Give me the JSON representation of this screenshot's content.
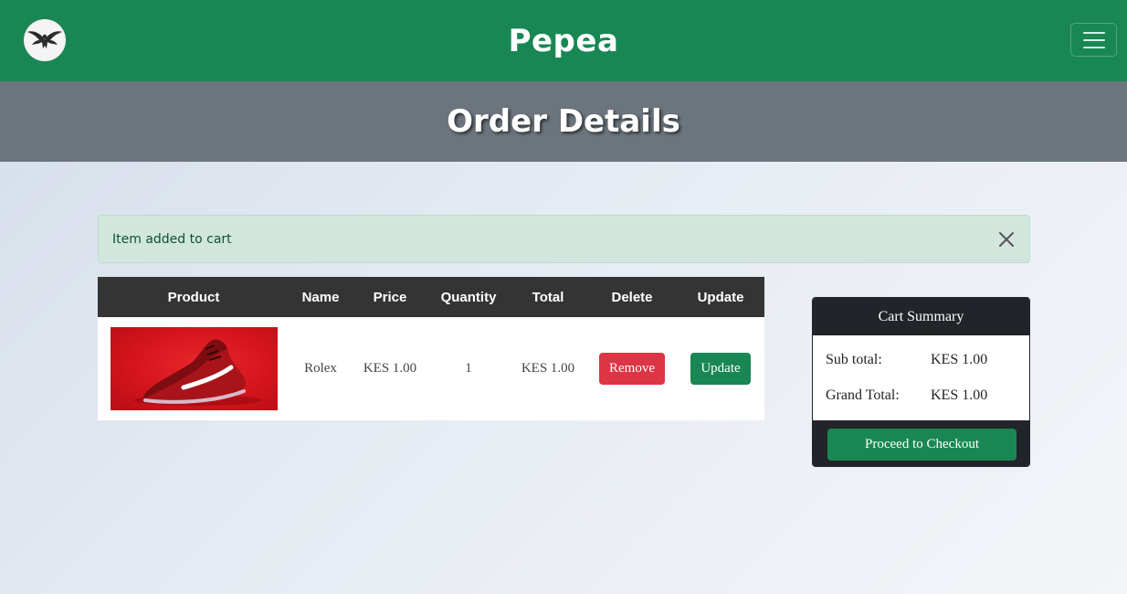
{
  "navbar": {
    "brand": "Pepea",
    "logo_icon": "dove-icon",
    "menu_icon": "hamburger-icon",
    "color": "#198754"
  },
  "page_header": {
    "title": "Order Details",
    "color": "#6c757d"
  },
  "alert": {
    "message": "Item added to cart",
    "close_icon": "close-icon"
  },
  "cart_table": {
    "columns": [
      "Product",
      "Name",
      "Price",
      "Quantity",
      "Total",
      "Delete",
      "Update"
    ],
    "rows": [
      {
        "product_image": "red-sneaker-image",
        "name": "Rolex",
        "price": "KES 1.00",
        "quantity": "1",
        "total": "KES 1.00",
        "delete_label": "Remove",
        "update_label": "Update"
      }
    ]
  },
  "cart_summary": {
    "title": "Cart Summary",
    "subtotal_label": "Sub total:",
    "subtotal_value": "KES 1.00",
    "grand_total_label": "Grand Total:",
    "grand_total_value": "KES 1.00",
    "checkout_label": "Proceed to Checkout"
  },
  "colors": {
    "primary_green": "#198754",
    "danger_red": "#dc3545",
    "dark": "#212529",
    "alert_bg": "#d1e7dd"
  }
}
